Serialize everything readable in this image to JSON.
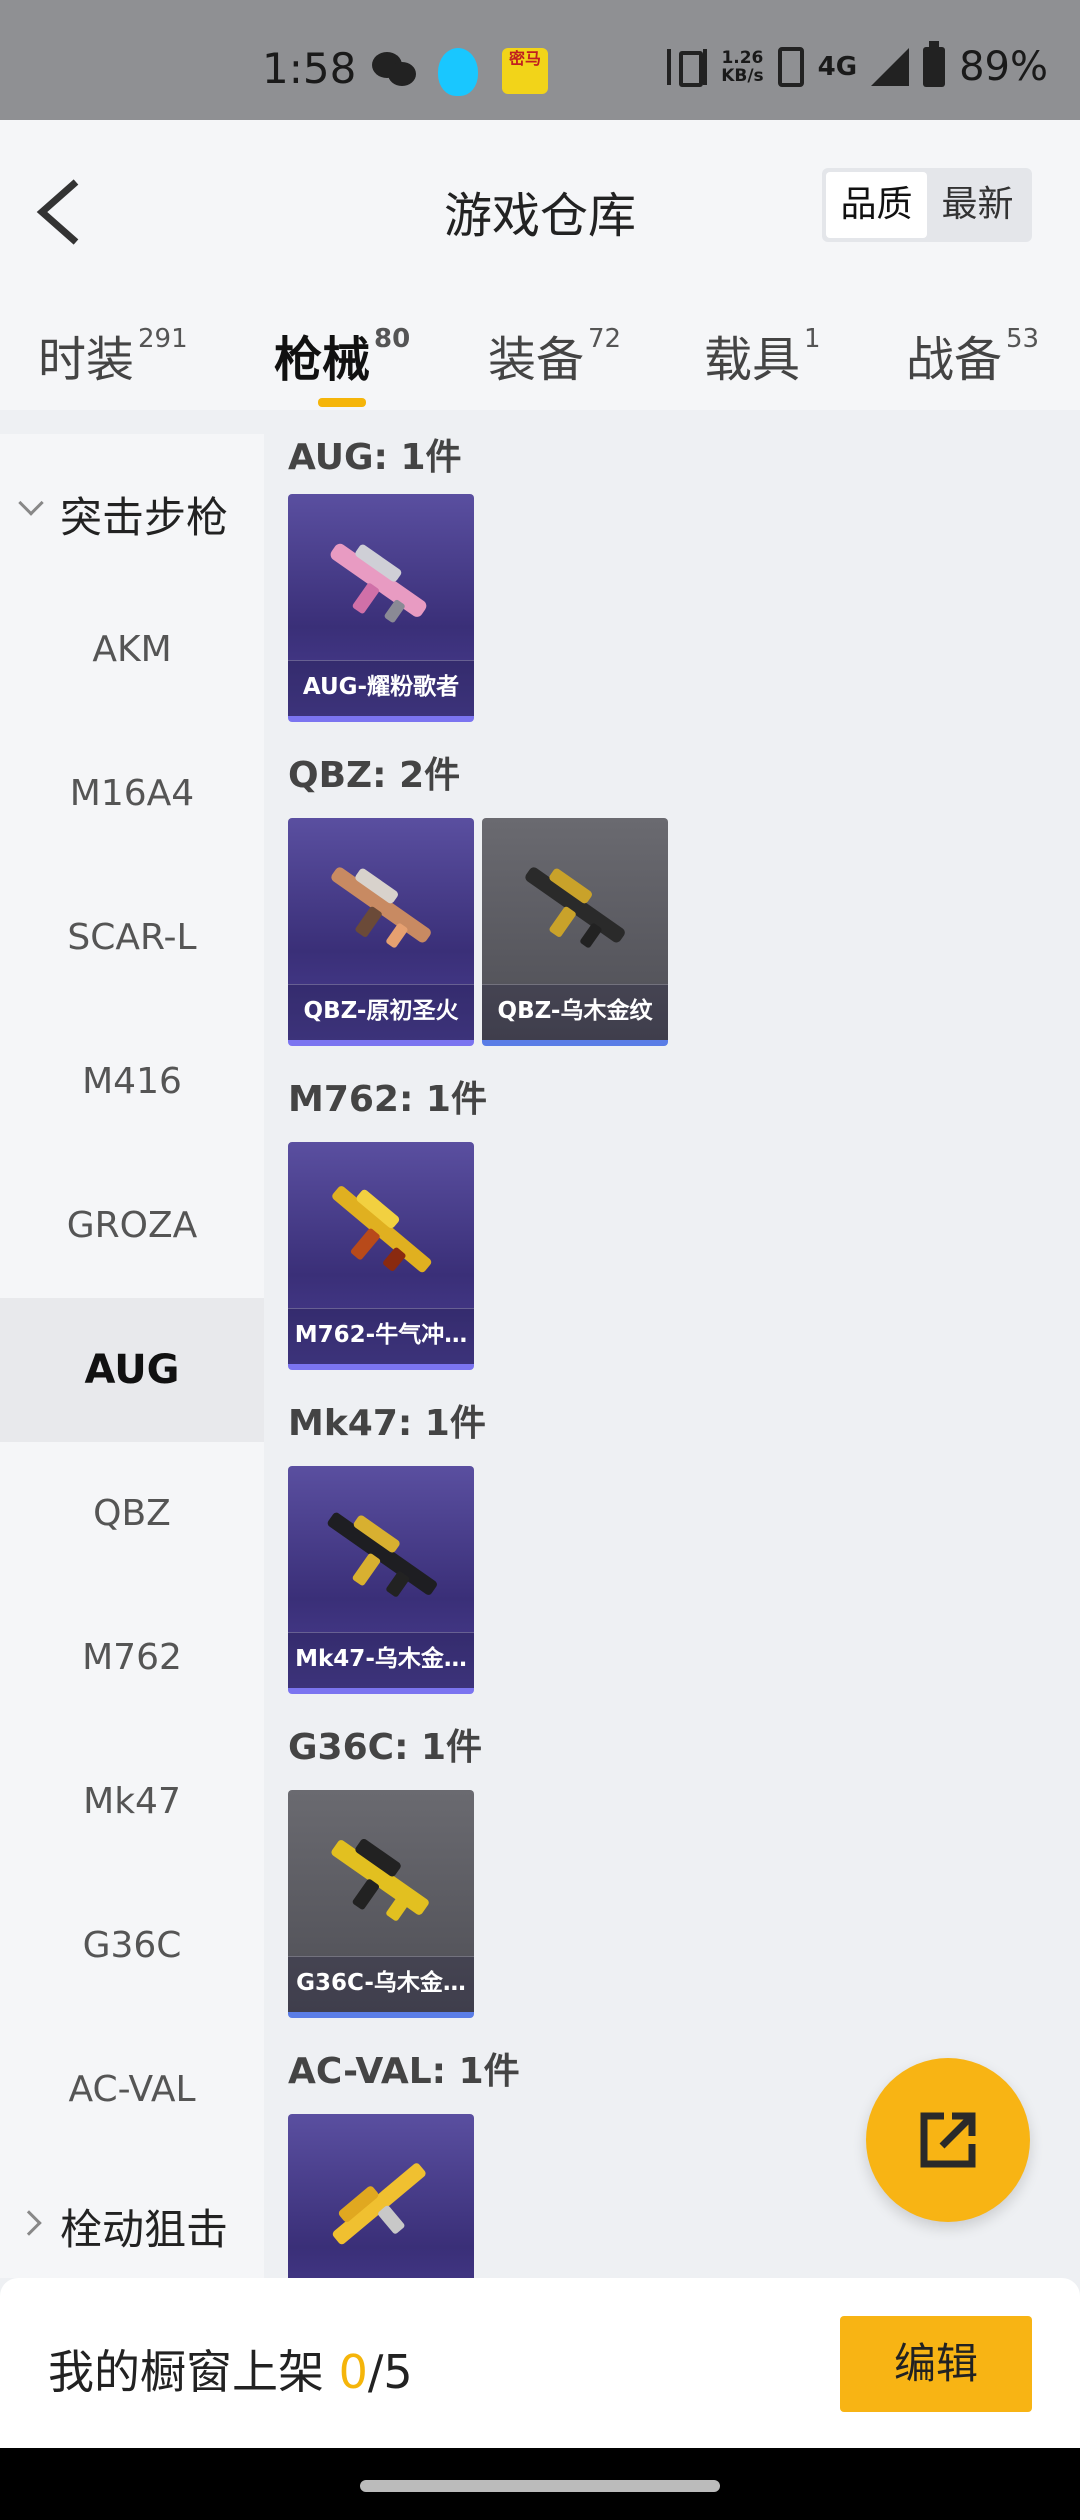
{
  "status_bar": {
    "time": "1:58",
    "net_speed_value": "1.26",
    "net_speed_unit": "KB/s",
    "network": "4G",
    "battery": "89%",
    "app_icon_text": "密马"
  },
  "header": {
    "title": "游戏仓库",
    "sort_options": [
      "品质",
      "最新"
    ],
    "active_sort": "品质"
  },
  "tabs": [
    {
      "label": "时装",
      "count": "291"
    },
    {
      "label": "枪械",
      "count": "80"
    },
    {
      "label": "装备",
      "count": "72"
    },
    {
      "label": "载具",
      "count": "1"
    },
    {
      "label": "战备",
      "count": "53"
    }
  ],
  "active_tab": "枪械",
  "sidebar": {
    "category_expanded": "突击步枪",
    "items": [
      "AKM",
      "M16A4",
      "SCAR-L",
      "M416",
      "GROZA",
      "AUG",
      "QBZ",
      "M762",
      "Mk47",
      "G36C",
      "AC-VAL"
    ],
    "active_item": "AUG",
    "category_collapsed": "栓动狙击"
  },
  "groups": [
    {
      "label": "AUG: 1件",
      "items": [
        {
          "name": "AUG-耀粉歌者",
          "rarity": "purple"
        }
      ]
    },
    {
      "label": "QBZ: 2件",
      "items": [
        {
          "name": "QBZ-原初圣火",
          "rarity": "purple"
        },
        {
          "name": "QBZ-乌木金纹",
          "rarity": "gray"
        }
      ]
    },
    {
      "label": "M762: 1件",
      "items": [
        {
          "name": "M762-牛气冲…",
          "rarity": "purple"
        }
      ]
    },
    {
      "label": "Mk47: 1件",
      "items": [
        {
          "name": "Mk47-乌木金…",
          "rarity": "purple"
        }
      ]
    },
    {
      "label": "G36C: 1件",
      "items": [
        {
          "name": "G36C-乌木金…",
          "rarity": "gray"
        }
      ]
    },
    {
      "label": "AC-VAL: 1件",
      "items": [
        {
          "name": "",
          "rarity": "purple"
        }
      ]
    }
  ],
  "bottom": {
    "shelf_text": "我的橱窗上架 ",
    "shelf_used": "0",
    "shelf_total": "/5",
    "edit_label": "编辑"
  },
  "colors": {
    "accent": "#f8b414",
    "purple_card": "#4a3f92",
    "gray_card": "#55555c"
  }
}
